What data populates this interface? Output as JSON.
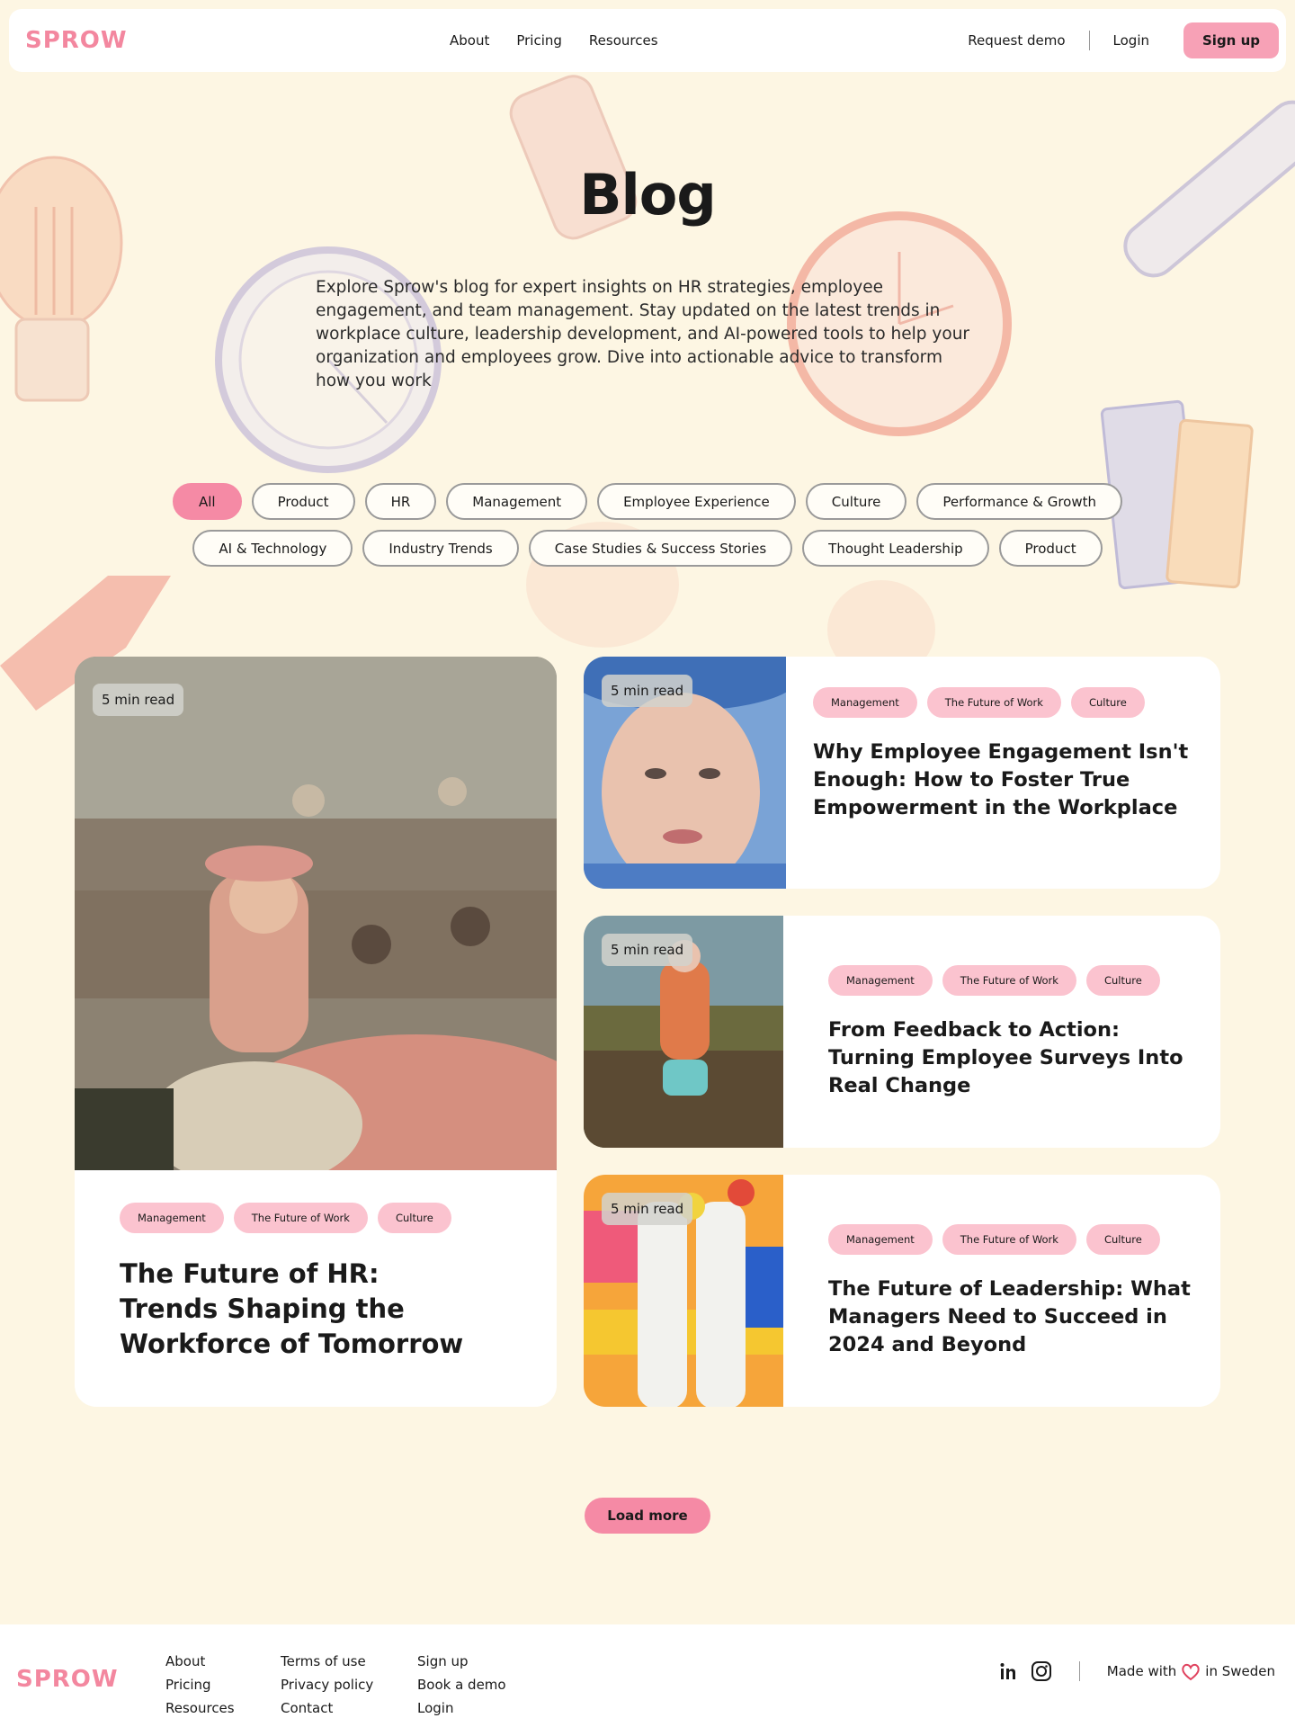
{
  "header": {
    "logo": "SPROW",
    "nav": [
      "About",
      "Pricing",
      "Resources"
    ],
    "request_demo": "Request demo",
    "login": "Login",
    "signup": "Sign up"
  },
  "hero": {
    "title": "Blog",
    "intro": "Explore Sprow's blog for expert insights on HR strategies, employee engagement, and team management. Stay updated on the latest trends in workplace culture, leadership development, and AI-powered tools to help your organization and employees grow. Dive into actionable advice to transform how you work"
  },
  "filters": {
    "row1": [
      "All",
      "Product",
      "HR",
      "Management",
      "Employee Experience",
      "Culture",
      "Performance & Growth"
    ],
    "row2": [
      "AI & Technology",
      "Industry Trends",
      "Case Studies & Success Stories",
      "Thought Leadership",
      "Product"
    ],
    "active": "All"
  },
  "posts": [
    {
      "read_time": "5 min read",
      "tags": [
        "Management",
        "The Future of Work",
        "Culture"
      ],
      "title": "The Future of HR: Trends Shaping the Workforce of Tomorrow"
    },
    {
      "read_time": "5 min read",
      "tags": [
        "Management",
        "The Future of Work",
        "Culture"
      ],
      "title": "Why Employee Engagement Isn't Enough: How to Foster True Empowerment in the Workplace"
    },
    {
      "read_time": "5 min read",
      "tags": [
        "Management",
        "The Future of Work",
        "Culture"
      ],
      "title": "From Feedback to Action: Turning Employee Surveys Into Real Change"
    },
    {
      "read_time": "5 min read",
      "tags": [
        "Management",
        "The Future of Work",
        "Culture"
      ],
      "title": "The Future of Leadership: What Managers Need to Succeed in 2024 and Beyond"
    }
  ],
  "load_more": "Load more",
  "footer": {
    "logo": "SPROW",
    "col1": [
      "About",
      "Pricing",
      "Resources"
    ],
    "col2": [
      "Terms of use",
      "Privacy policy",
      "Contact"
    ],
    "col3": [
      "Sign up",
      "Book a demo",
      "Login"
    ],
    "made_with": "Made with",
    "in_sweden": "in Sweden",
    "social_icons": [
      "linkedin-icon",
      "instagram-icon"
    ]
  },
  "colors": {
    "background": "#fdf6e3",
    "accent": "#f58aa5",
    "tag": "#fbc3cf"
  }
}
